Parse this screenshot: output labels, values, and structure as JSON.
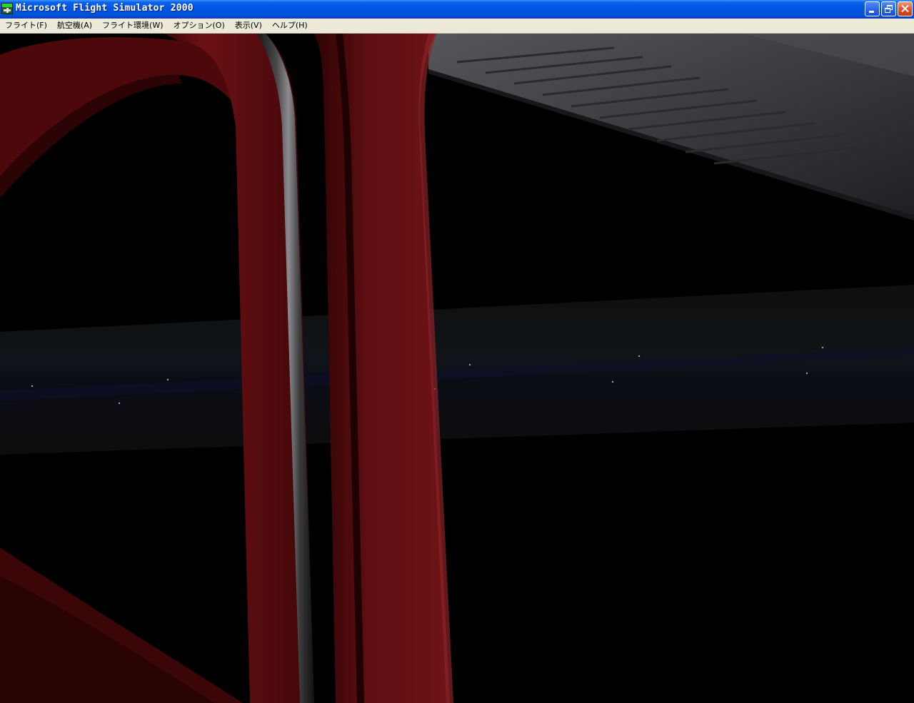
{
  "window": {
    "title": "Microsoft Flight Simulator 2000",
    "icon": "fs2000-app-icon",
    "controls": [
      "minimize-icon",
      "restore-icon",
      "close-icon"
    ]
  },
  "menu": [
    {
      "label": "フライト(F)"
    },
    {
      "label": "航空機(A)"
    },
    {
      "label": "フライト環境(W)"
    },
    {
      "label": "オプション(O)"
    },
    {
      "label": "表示(V)"
    },
    {
      "label": "ヘルプ(H)"
    }
  ],
  "viewport": {
    "scene": "night view from aircraft cockpit through red window frame",
    "colors": {
      "frame": "#6a0f12",
      "frame_dark": "#3a0608",
      "sky": "#000000",
      "ground_band": "#0c0d0c",
      "wing": "#3a3b3f"
    }
  }
}
